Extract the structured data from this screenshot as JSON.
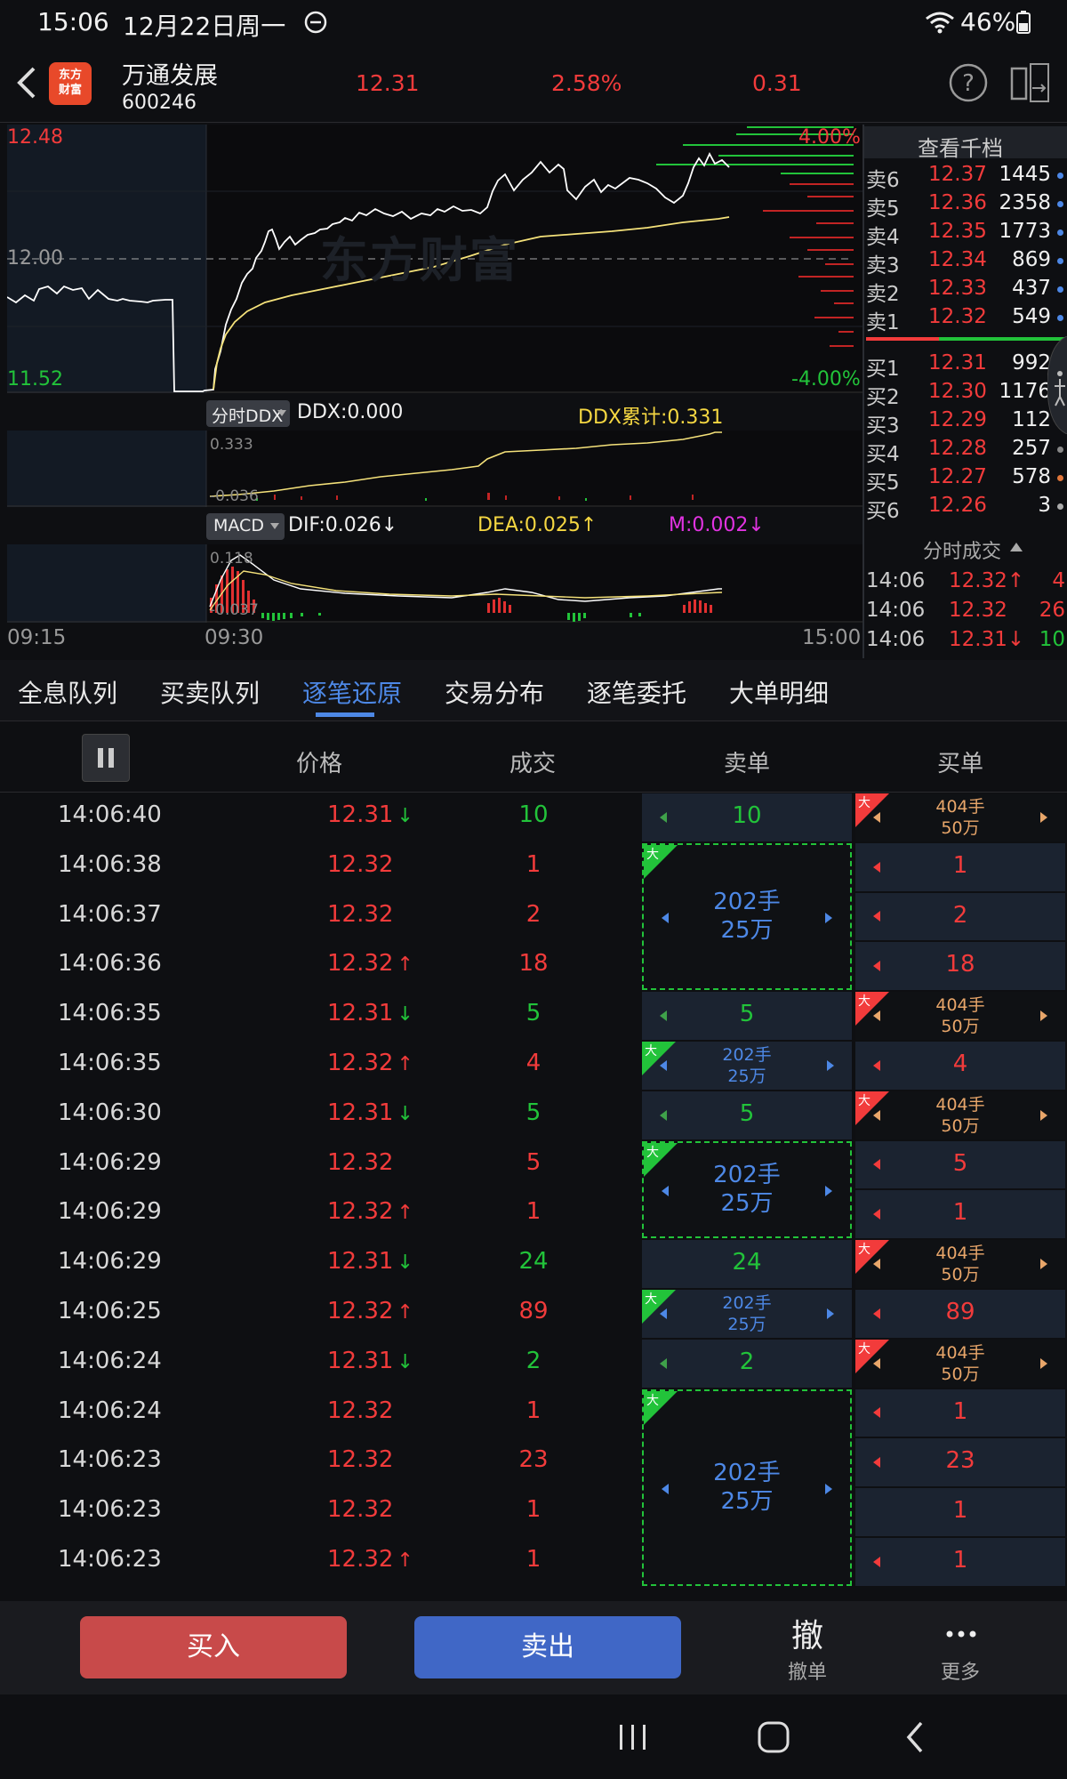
{
  "status_bar": {
    "time": "15:06",
    "date": "12月22日周一",
    "battery": "46%",
    "icons": [
      "dnd-icon",
      "wifi-icon",
      "battery-icon"
    ]
  },
  "header": {
    "logo_line1": "东方",
    "logo_line2": "财富",
    "stock_name": "万通发展",
    "stock_code": "600246",
    "price": "12.31",
    "change_pct": "2.58%",
    "change": "0.31"
  },
  "main_chart": {
    "price_high": "12.48",
    "price_mid": "12.00",
    "price_low": "11.52",
    "pct_high": "4.00%",
    "pct_low": "-4.00%",
    "watermark": "东方财富",
    "time_start": "09:15",
    "time_open": "09:30",
    "time_end": "15:00"
  },
  "ddx": {
    "selector": "分时DDX",
    "ddx_label": "DDX:0.000",
    "ddx_cum": "DDX累计:0.331",
    "top_value": "0.333",
    "bottom_value": "-0.036"
  },
  "macd": {
    "selector": "MACD",
    "dif": "DIF:0.026↓",
    "dea": "DEA:0.025↑",
    "m": "M:0.002↓",
    "top_value": "0.118",
    "bottom_value": "-0.037"
  },
  "order_book": {
    "title": "查看千档",
    "sells": [
      {
        "label": "卖6",
        "price": "12.37",
        "vol": "1445"
      },
      {
        "label": "卖5",
        "price": "12.36",
        "vol": "2358"
      },
      {
        "label": "卖4",
        "price": "12.35",
        "vol": "1773"
      },
      {
        "label": "卖3",
        "price": "12.34",
        "vol": "869"
      },
      {
        "label": "卖2",
        "price": "12.33",
        "vol": "437"
      },
      {
        "label": "卖1",
        "price": "12.32",
        "vol": "549"
      }
    ],
    "buys": [
      {
        "label": "买1",
        "price": "12.31",
        "vol": "992"
      },
      {
        "label": "买2",
        "price": "12.30",
        "vol": "1176"
      },
      {
        "label": "买3",
        "price": "12.29",
        "vol": "112"
      },
      {
        "label": "买4",
        "price": "12.28",
        "vol": "257"
      },
      {
        "label": "买5",
        "price": "12.27",
        "vol": "578"
      },
      {
        "label": "买6",
        "price": "12.26",
        "vol": "3"
      }
    ],
    "ticks_title": "分时成交",
    "ticks": [
      {
        "time": "14:06",
        "price": "12.32↑",
        "vol": "4"
      },
      {
        "time": "14:06",
        "price": "12.32",
        "vol": "26"
      },
      {
        "time": "14:06",
        "price": "12.31↓",
        "vol": "10"
      }
    ]
  },
  "tabs": [
    "全息队列",
    "买卖队列",
    "逐笔还原",
    "交易分布",
    "逐笔委托",
    "大单明细"
  ],
  "table": {
    "headers": {
      "price": "价格",
      "volume": "成交",
      "sell": "卖单",
      "buy": "买单"
    },
    "rows": [
      {
        "time": "14:06:40",
        "price": "12.31",
        "dir": "down",
        "vol": "10"
      },
      {
        "time": "14:06:38",
        "price": "12.32",
        "dir": "",
        "vol": "1"
      },
      {
        "time": "14:06:37",
        "price": "12.32",
        "dir": "",
        "vol": "2"
      },
      {
        "time": "14:06:36",
        "price": "12.32",
        "dir": "up",
        "vol": "18"
      },
      {
        "time": "14:06:35",
        "price": "12.31",
        "dir": "down",
        "vol": "5"
      },
      {
        "time": "14:06:35",
        "price": "12.32",
        "dir": "up",
        "vol": "4"
      },
      {
        "time": "14:06:30",
        "price": "12.31",
        "dir": "down",
        "vol": "5"
      },
      {
        "time": "14:06:29",
        "price": "12.32",
        "dir": "",
        "vol": "5"
      },
      {
        "time": "14:06:29",
        "price": "12.32",
        "dir": "up",
        "vol": "1"
      },
      {
        "time": "14:06:29",
        "price": "12.31",
        "dir": "down",
        "vol": "24"
      },
      {
        "time": "14:06:25",
        "price": "12.32",
        "dir": "up",
        "vol": "89"
      },
      {
        "time": "14:06:24",
        "price": "12.31",
        "dir": "down",
        "vol": "2"
      },
      {
        "time": "14:06:24",
        "price": "12.32",
        "dir": "",
        "vol": "1"
      },
      {
        "time": "14:06:23",
        "price": "12.32",
        "dir": "",
        "vol": "23"
      },
      {
        "time": "14:06:23",
        "price": "12.32",
        "dir": "",
        "vol": "1"
      },
      {
        "time": "14:06:23",
        "price": "12.32",
        "dir": "up",
        "vol": "1"
      }
    ],
    "big_flag": "大",
    "big_sell_line1": "202手",
    "big_sell_line2": "25万",
    "big_buy_line1": "404手",
    "big_buy_line2": "50万"
  },
  "bottom": {
    "buy": "买入",
    "sell": "卖出",
    "cancel_icon": "撤",
    "cancel": "撤单",
    "more": "更多"
  },
  "colors": {
    "up": "#f23b3b",
    "down": "#22c33a",
    "accent": "#4d88e6",
    "avg_line": "#f5e27a"
  }
}
